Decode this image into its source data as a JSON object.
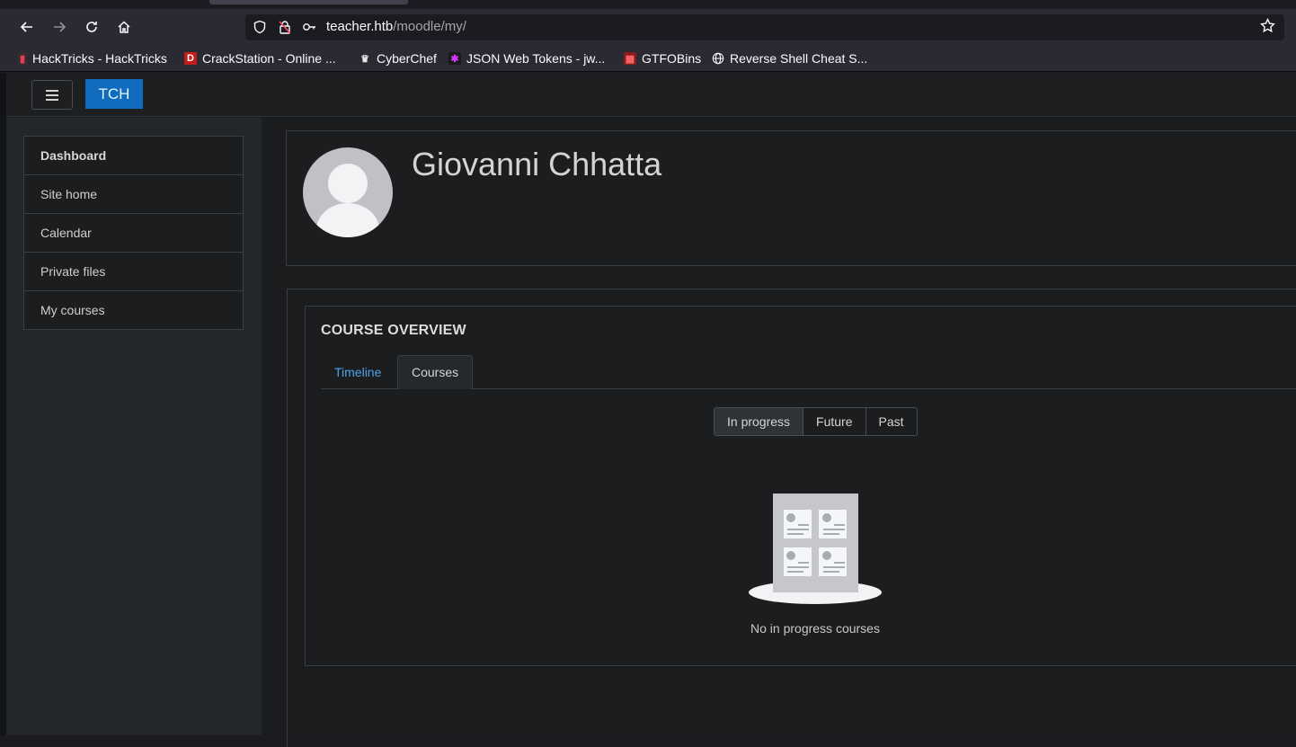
{
  "browser": {
    "url_host": "teacher.htb",
    "url_path": "/moodle/my/",
    "bookmarks": [
      {
        "label": "HackTricks - HackTricks",
        "icon": "hacktricks-icon"
      },
      {
        "label": "CrackStation - Online ...",
        "icon": "crackstation-icon"
      },
      {
        "label": "CyberChef",
        "icon": "cyberchef-icon"
      },
      {
        "label": "JSON Web Tokens - jw...",
        "icon": "jwt-icon"
      },
      {
        "label": "GTFOBins",
        "icon": "gtfobins-icon"
      },
      {
        "label": "Reverse Shell Cheat S...",
        "icon": "globe-icon"
      }
    ]
  },
  "site": {
    "brand": "TCH"
  },
  "nav": {
    "items": [
      {
        "label": "Dashboard"
      },
      {
        "label": "Site home"
      },
      {
        "label": "Calendar"
      },
      {
        "label": "Private files"
      },
      {
        "label": "My courses"
      }
    ]
  },
  "header": {
    "user_name": "Giovanni Chhatta"
  },
  "overview": {
    "title": "COURSE OVERVIEW",
    "tabs": [
      {
        "label": "Timeline"
      },
      {
        "label": "Courses"
      }
    ],
    "filters": [
      {
        "label": "In progress"
      },
      {
        "label": "Future"
      },
      {
        "label": "Past"
      }
    ],
    "empty_message": "No in progress courses"
  },
  "colors": {
    "brand": "#0f6cbf",
    "link": "#4ea3e8"
  }
}
